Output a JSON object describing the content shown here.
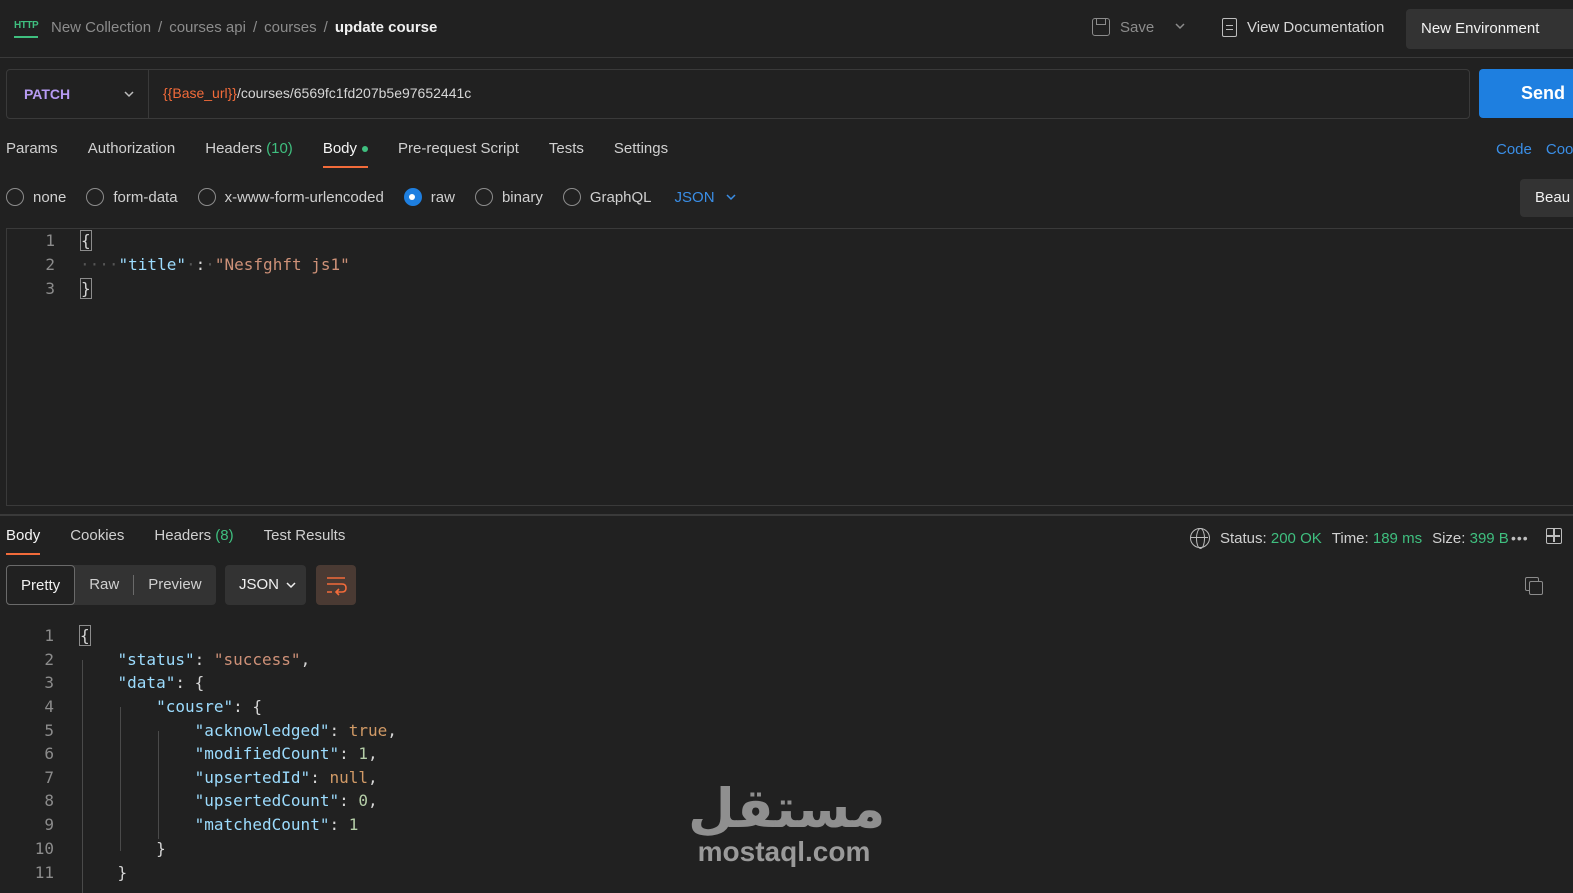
{
  "topbar": {
    "icon_label": "HTTP",
    "breadcrumb": [
      "New Collection",
      "courses api",
      "courses"
    ],
    "current": "update course",
    "save_label": "Save",
    "view_doc_label": "View Documentation",
    "environment_label": "New Environment"
  },
  "request": {
    "method": "PATCH",
    "url_variable": "{{Base_url}}",
    "url_path": "/courses/6569fc1fd207b5e97652441c",
    "send_label": "Send"
  },
  "request_tabs": {
    "params": "Params",
    "authorization": "Authorization",
    "headers": "Headers",
    "headers_count": "(10)",
    "body": "Body",
    "prerequest": "Pre-request Script",
    "tests": "Tests",
    "settings": "Settings",
    "code_link": "Code",
    "cookies_link": "Coo"
  },
  "body_types": {
    "none": "none",
    "form_data": "form-data",
    "urlencoded": "x-www-form-urlencoded",
    "raw": "raw",
    "binary": "binary",
    "graphql": "GraphQL",
    "format": "JSON",
    "beautify": "Beau"
  },
  "request_body": {
    "l1": "{",
    "key": "\"title\"",
    "colon": ":",
    "value": "\"Nesfghft js1\"",
    "l3": "}"
  },
  "response_tabs": {
    "body": "Body",
    "cookies": "Cookies",
    "headers": "Headers",
    "headers_count": "(8)",
    "test_results": "Test Results"
  },
  "response_meta": {
    "status_label": "Status:",
    "status_value": "200 OK",
    "time_label": "Time:",
    "time_value": "189 ms",
    "size_label": "Size:",
    "size_value": "399 B",
    "more": "•••"
  },
  "response_view": {
    "pretty": "Pretty",
    "raw": "Raw",
    "preview": "Preview",
    "format": "JSON"
  },
  "response_body": {
    "open": "{",
    "status_key": "\"status\"",
    "status_val": "\"success\"",
    "data_key": "\"data\"",
    "cousre_key": "\"cousre\"",
    "ack_key": "\"acknowledged\"",
    "ack_val": "true",
    "mod_key": "\"modifiedCount\"",
    "mod_val": "1",
    "upid_key": "\"upsertedId\"",
    "upid_val": "null",
    "upcnt_key": "\"upsertedCount\"",
    "upcnt_val": "0",
    "match_key": "\"matchedCount\"",
    "match_val": "1",
    "close_inner": "}",
    "close_data": "}"
  },
  "watermark": {
    "arabic": "مستقل",
    "latin": "mostaql.com"
  },
  "colors": {
    "accent_orange": "#f26b3a",
    "send_blue": "#1e7fe0",
    "success_green": "#3fbf7f",
    "method_purple": "#b79bf2"
  }
}
